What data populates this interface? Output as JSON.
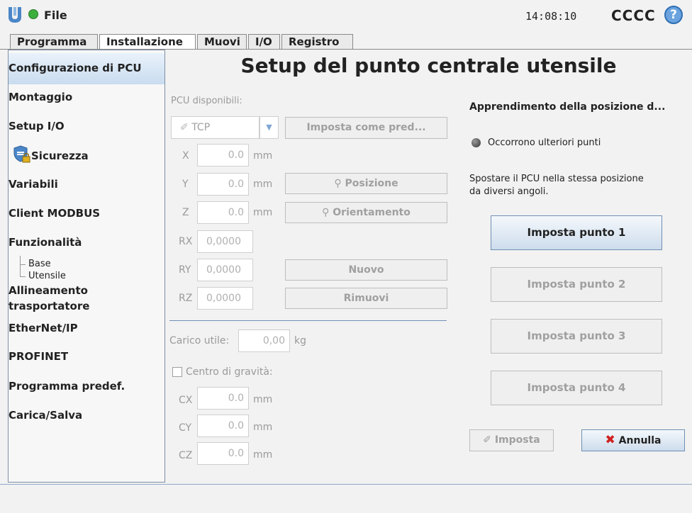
{
  "topbar": {
    "file": "File",
    "time": "14:08:10",
    "robot": "CCCC",
    "help": "?"
  },
  "tabs": [
    "Programma",
    "Installazione",
    "Muovi",
    "I/O",
    "Registro"
  ],
  "sidebar": {
    "items": [
      "Configurazione di PCU",
      "Montaggio",
      "Setup I/O",
      "Sicurezza",
      "Variabili",
      "Client MODBUS",
      "Funzionalità"
    ],
    "sub_items": [
      "Base",
      "Utensile"
    ],
    "items2": [
      "Allineamento",
      "trasportatore",
      "EtherNet/IP",
      "PROFINET",
      "Programma predef.",
      "Carica/Salva"
    ]
  },
  "main": {
    "title": "Setup del punto centrale utensile",
    "pcu_label": "PCU disponibili:",
    "tcp_value": "TCP",
    "set_default_label": "Imposta come pred...",
    "coords": [
      {
        "label": "X",
        "value": "0.0",
        "unit": "mm"
      },
      {
        "label": "Y",
        "value": "0.0",
        "unit": "mm"
      },
      {
        "label": "Z",
        "value": "0.0",
        "unit": "mm"
      },
      {
        "label": "RX",
        "value": "0,0000"
      },
      {
        "label": "RY",
        "value": "0,0000"
      },
      {
        "label": "RZ",
        "value": "0,0000"
      }
    ],
    "position_label": "Posizione",
    "orientation_label": "Orientamento",
    "new_label": "Nuovo",
    "remove_label": "Rimuovi",
    "payload_label": "Carico utile:",
    "payload_value": "0,00",
    "payload_unit": "kg",
    "cog_label": "Centro di gravità:",
    "cog": [
      {
        "label": "CX",
        "value": "0.0",
        "unit": "mm"
      },
      {
        "label": "CY",
        "value": "0.0",
        "unit": "mm"
      },
      {
        "label": "CZ",
        "value": "0.0",
        "unit": "mm"
      }
    ]
  },
  "teach": {
    "heading": "Apprendimento della posizione d...",
    "status": "Occorrono ulteriori punti",
    "instructions_1": "Spostare il PCU nella stessa posizione",
    "instructions_2": "da diversi angoli.",
    "points": [
      "Imposta punto 1",
      "Imposta punto 2",
      "Imposta punto 3",
      "Imposta punto 4"
    ],
    "set_label": "Imposta",
    "cancel_label": "Annulla"
  }
}
